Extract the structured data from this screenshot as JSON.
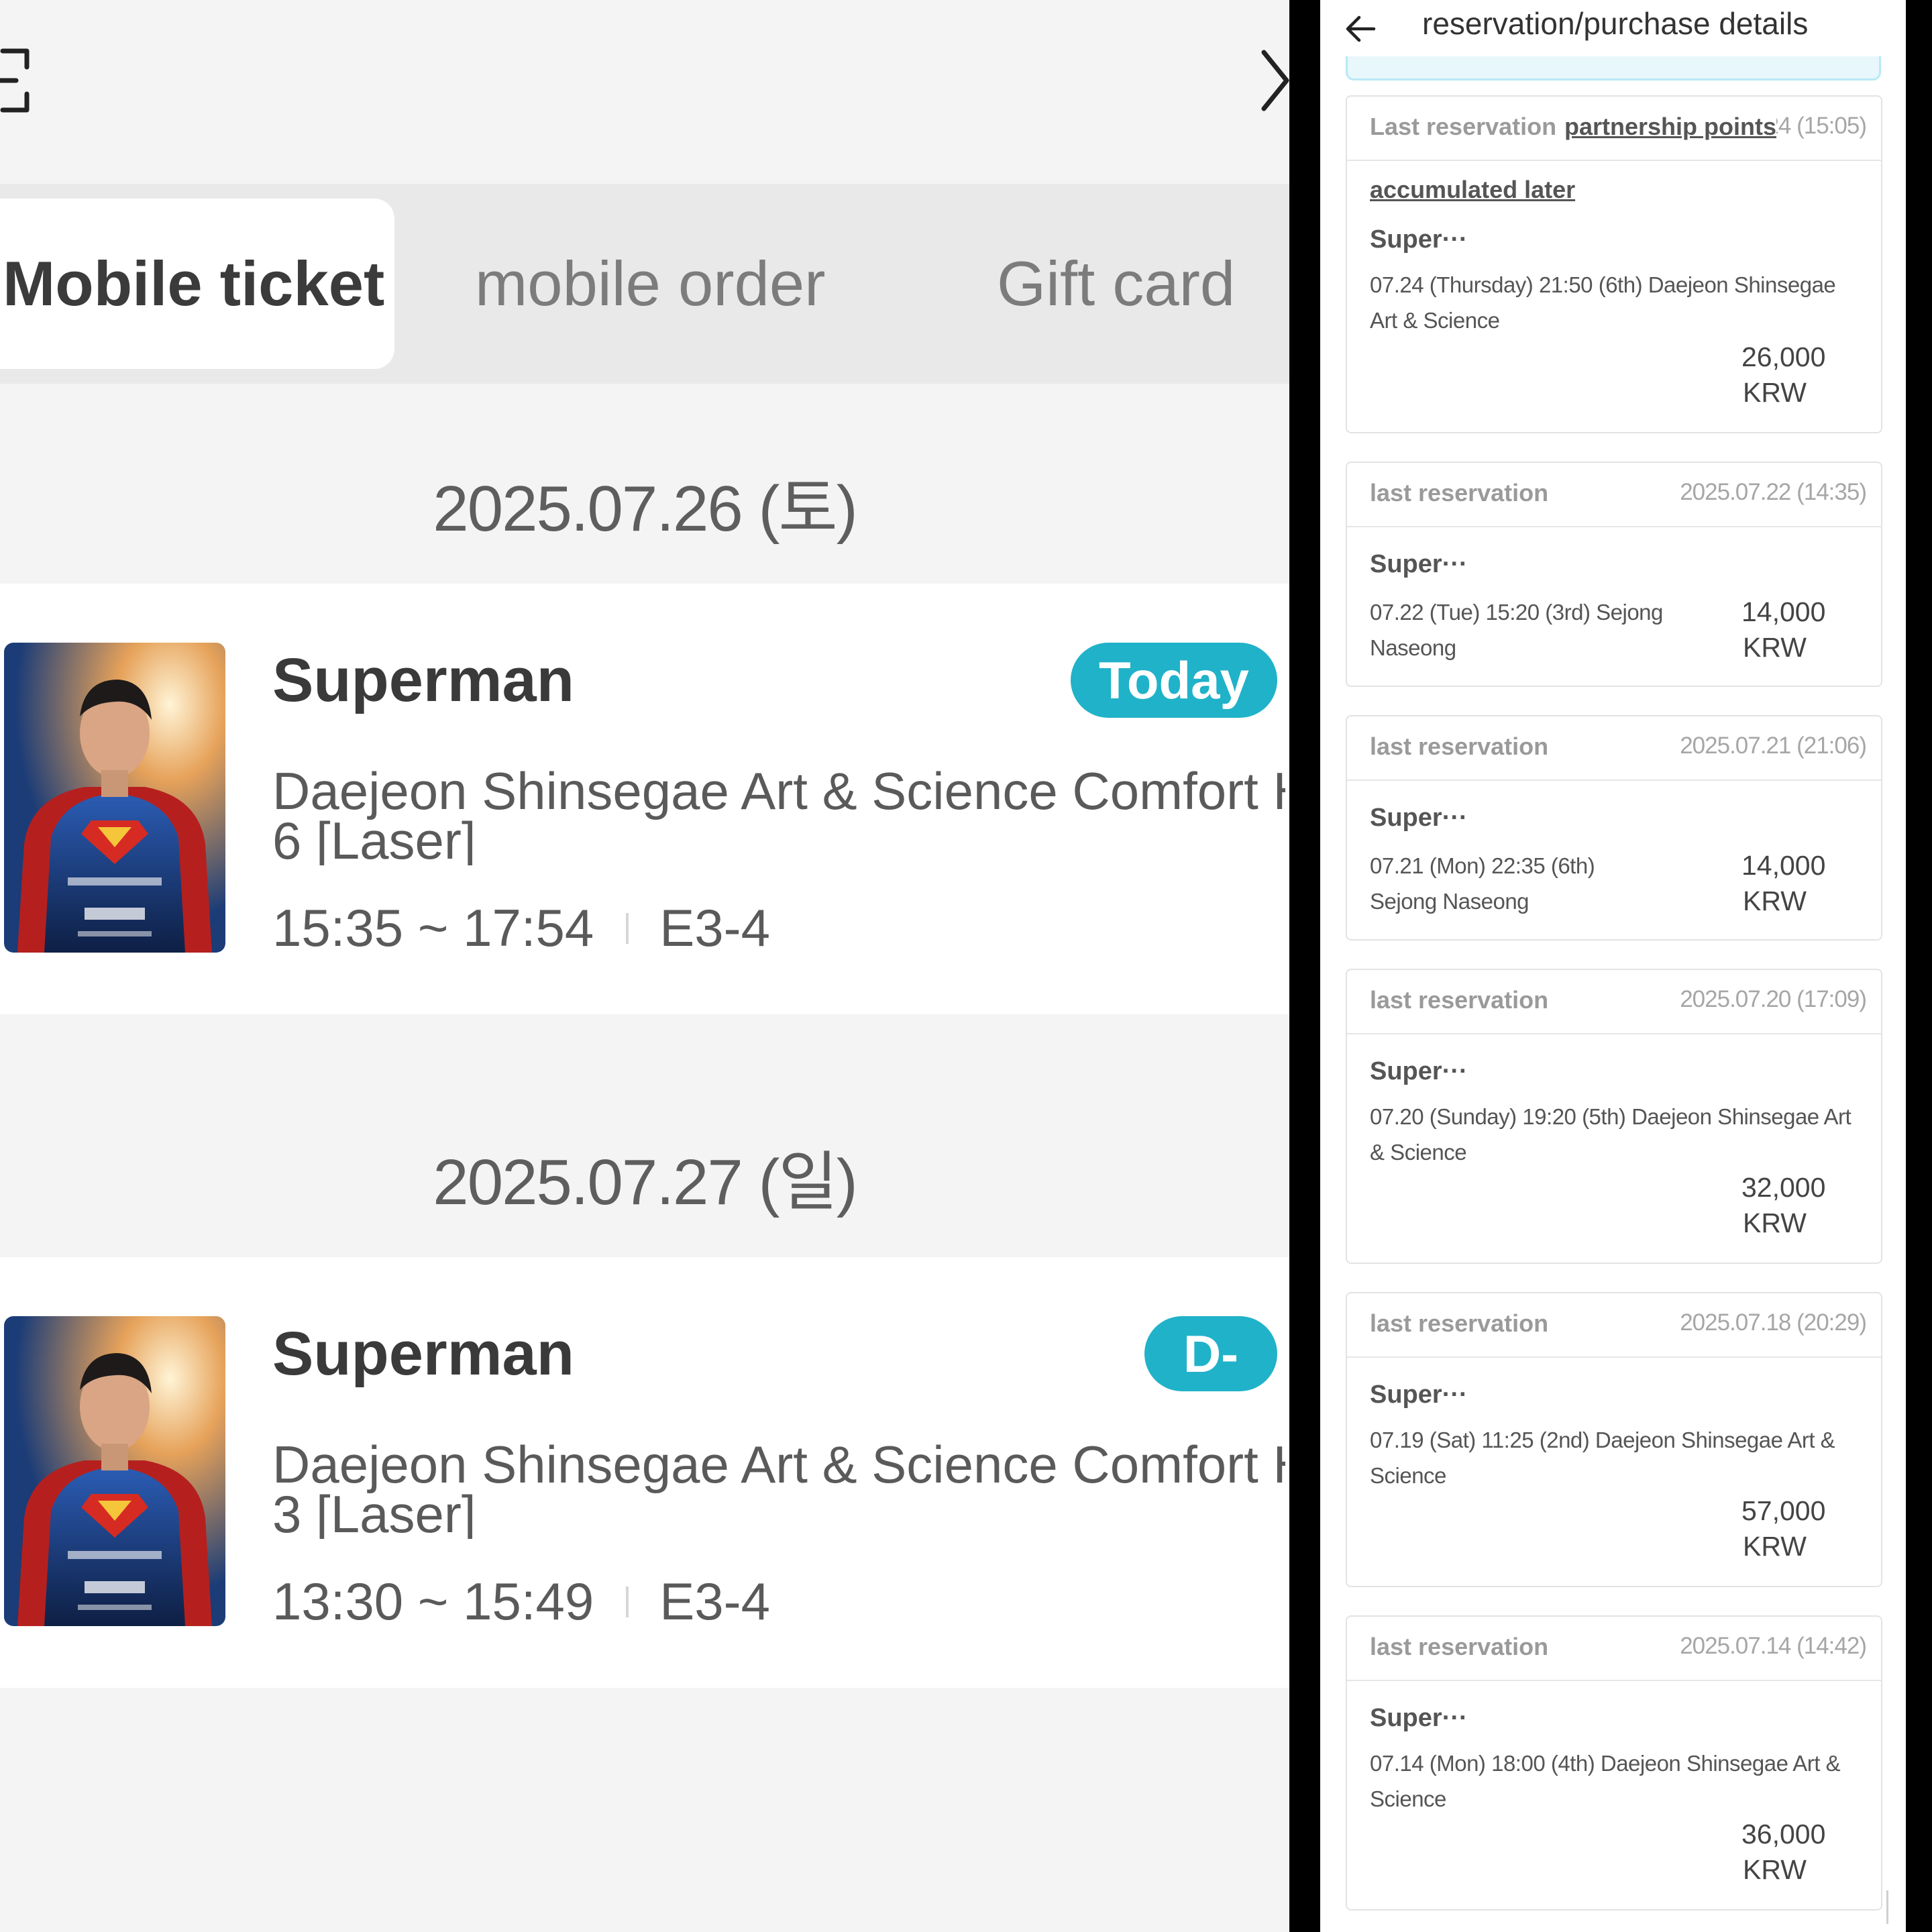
{
  "left": {
    "icons": {
      "scan": "scan-icon",
      "next": "chevron-right-icon"
    },
    "tabs": [
      {
        "label": "Mobile ticket",
        "active": true
      },
      {
        "label": "mobile order",
        "active": false
      },
      {
        "label": "Gift card",
        "active": false
      }
    ],
    "groups": [
      {
        "date": "2025.07.26 (토)",
        "ticket": {
          "title": "Superman",
          "badge": "Today",
          "venue_line1": "Daejeon Shinsegae Art & Science Comfort Hall",
          "venue_line2": "6 [Laser]",
          "time": "15:35 ~ 17:54",
          "seat": "E3-4"
        }
      },
      {
        "date": "2025.07.27 (일)",
        "ticket": {
          "title": "Superman",
          "badge": "D-",
          "venue_line1": "Daejeon Shinsegae Art & Science Comfort Hall",
          "venue_line2": "3 [Laser]",
          "time": "13:30 ~ 15:49",
          "seat": "E3-4"
        }
      }
    ],
    "colors": {
      "badge": "#20b2c9",
      "background": "#f4f4f4"
    }
  },
  "right": {
    "header": {
      "title": "reservation/purchase details",
      "back_icon": "arrow-left-icon"
    },
    "cards": [
      {
        "label": "Last reservation",
        "date": "2025.07.24 (15:05)",
        "link1": "partnership points",
        "link2": "accumulated later",
        "movie": "Super···",
        "detail": "07.24 (Thursday) 21:50 (6th) Daejeon Shinsegae Art & Science",
        "price_amount": "26,000",
        "price_currency": "KRW"
      },
      {
        "label": "last reservation",
        "date": "2025.07.22 (14:35)",
        "movie": "Super···",
        "detail": "07.22 (Tue) 15:20 (3rd) Sejong Naseong",
        "price_amount": "14,000",
        "price_currency": "KRW"
      },
      {
        "label": "last reservation",
        "date": "2025.07.21 (21:06)",
        "movie": "Super···",
        "detail": "07.21 (Mon) 22:35 (6th) Sejong Naseong",
        "price_amount": "14,000",
        "price_currency": "KRW"
      },
      {
        "label": "last reservation",
        "date": "2025.07.20 (17:09)",
        "movie": "Super···",
        "detail": "07.20 (Sunday) 19:20 (5th) Daejeon Shinsegae Art & Science",
        "price_amount": "32,000",
        "price_currency": "KRW"
      },
      {
        "label": "last reservation",
        "date": "2025.07.18 (20:29)",
        "movie": "Super···",
        "detail": "07.19 (Sat) 11:25 (2nd) Daejeon Shinsegae Art & Science",
        "price_amount": "57,000",
        "price_currency": "KRW"
      },
      {
        "label": "last reservation",
        "date": "2025.07.14 (14:42)",
        "movie": "Super···",
        "detail": "07.14 (Mon) 18:00 (4th) Daejeon Shinsegae Art & Science",
        "price_amount": "36,000",
        "price_currency": "KRW"
      }
    ]
  }
}
